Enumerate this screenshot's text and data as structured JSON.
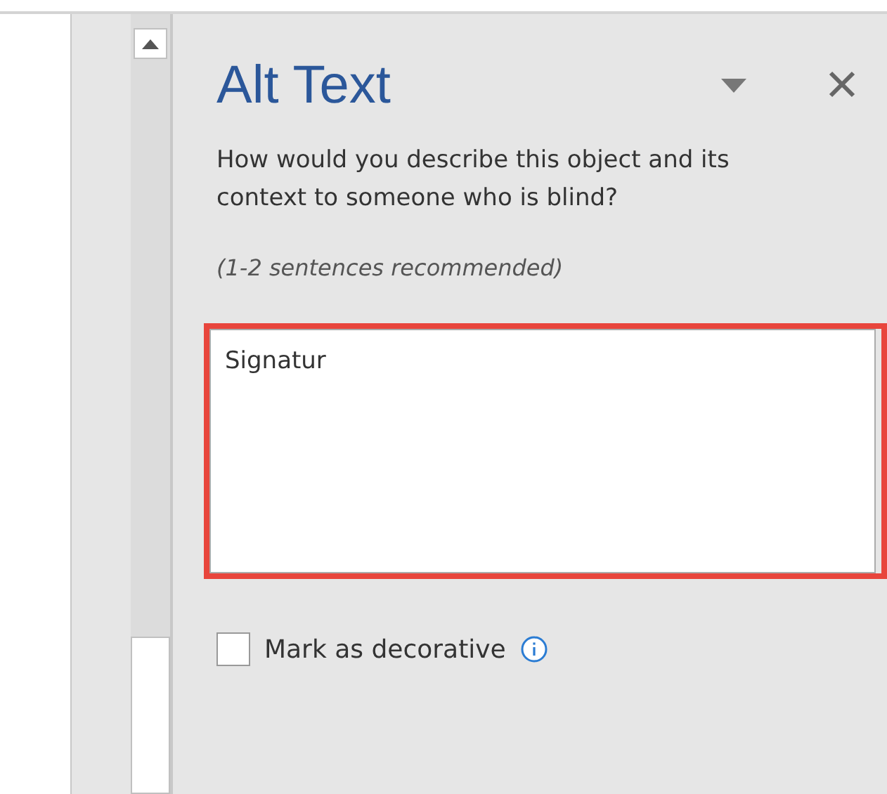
{
  "pane": {
    "title": "Alt Text",
    "question": "How would you describe this object and its context to someone who is blind?",
    "hint": "(1-2 sentences recommended)",
    "description": {
      "value": "Signatur",
      "highlighted": true
    },
    "decorative": {
      "label": "Mark as decorative",
      "checked": false
    }
  }
}
